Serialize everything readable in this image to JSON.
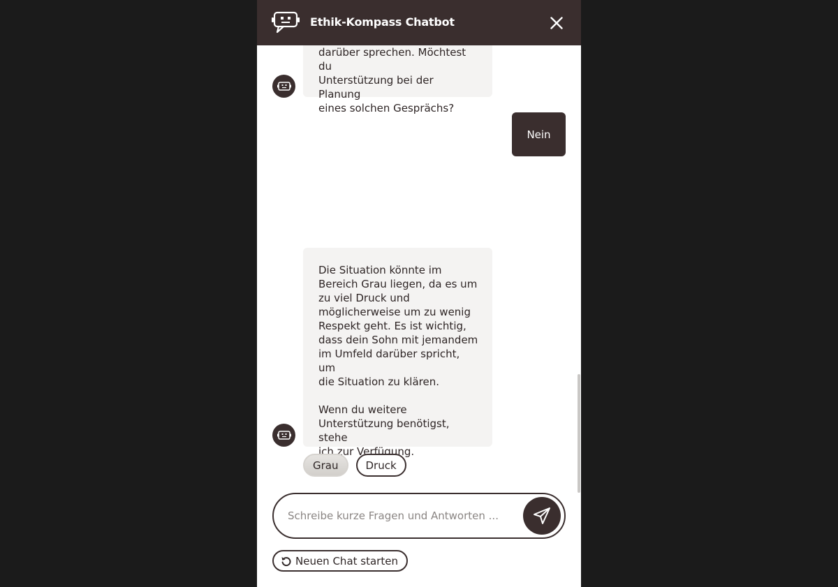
{
  "header": {
    "title": "Ethik-Kompass Chatbot",
    "logo_icon": "chatbot-icon",
    "close_icon": "close-icon"
  },
  "messages": [
    {
      "role": "bot",
      "text": "darüber sprechen. Möchtest du\nUnterstützung bei der Planung\neines solchen Gesprächs?"
    },
    {
      "role": "user",
      "text": "Nein"
    },
    {
      "role": "bot",
      "text": "Die Situation könnte im\nBereich Grau liegen, da es um\nzu viel Druck und\nmöglicherweise um zu wenig\nRespekt geht. Es ist wichtig,\ndass dein Sohn mit jemandem\nim Umfeld darüber spricht, um\ndie Situation zu klären.\n\nWenn du weitere\nUnterstützung benötigst, stehe\nich zur Verfügung."
    }
  ],
  "chips": [
    {
      "label": "Grau",
      "style": "filled"
    },
    {
      "label": "Druck",
      "style": "outline"
    }
  ],
  "input": {
    "placeholder": "Schreibe kurze Fragen und Antworten ...",
    "value": "",
    "send_icon": "send-icon"
  },
  "new_chat": {
    "label": "Neuen Chat starten",
    "icon": "restart-icon"
  },
  "colors": {
    "brand_dark": "#3a2e2e",
    "bubble_bg": "#f4f3f2",
    "backdrop": "#1b1b1b"
  }
}
